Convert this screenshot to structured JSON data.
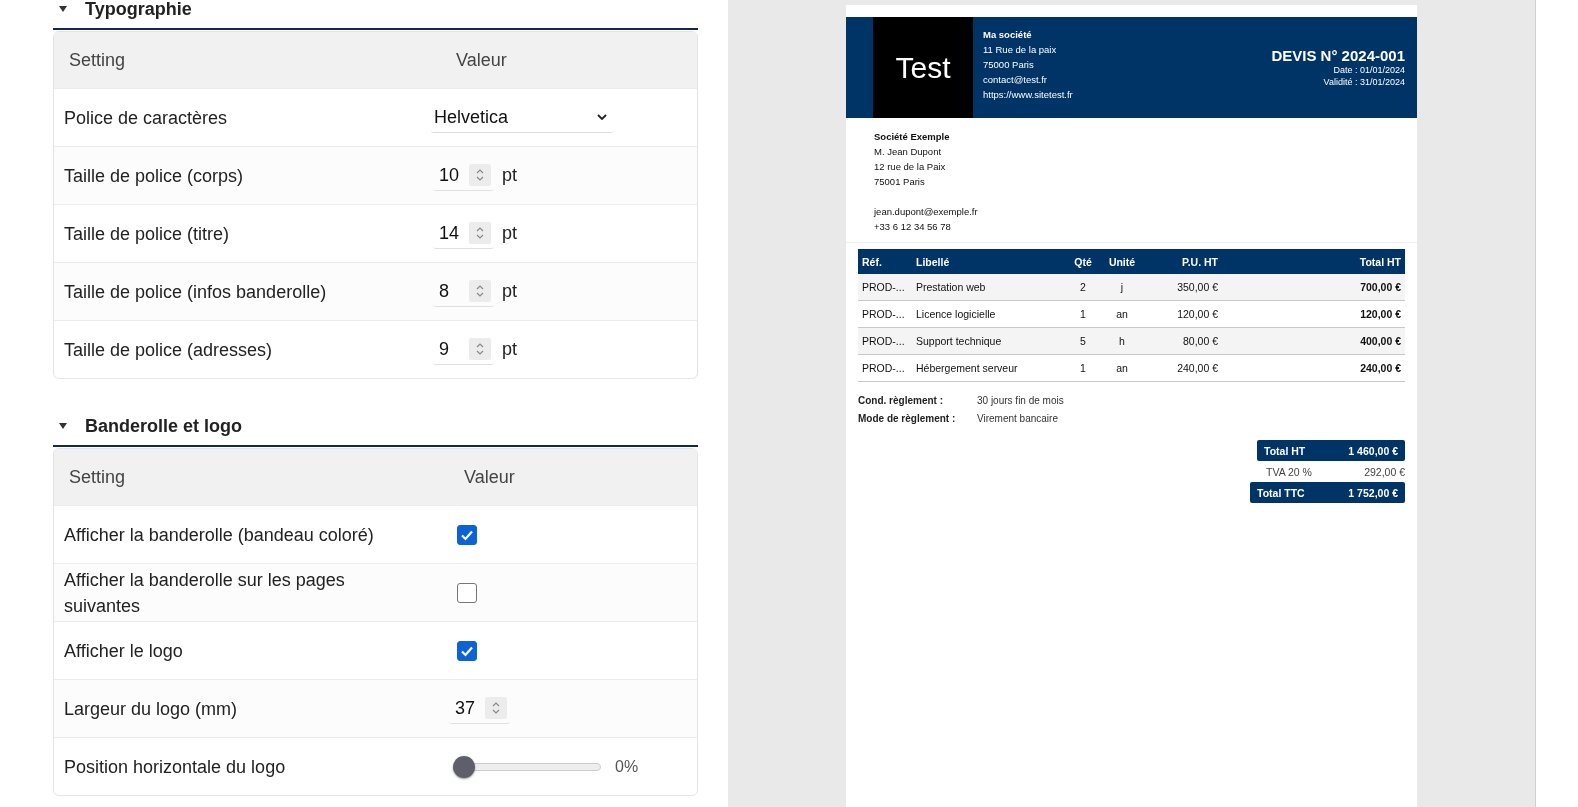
{
  "sections": [
    {
      "title": "Typographie",
      "expanded": true,
      "columns": [
        "Setting",
        "Valeur"
      ],
      "rows": [
        {
          "kind": "select",
          "label": "Police de caractères",
          "value": "Helvetica"
        },
        {
          "kind": "number",
          "label": "Taille de police (corps)",
          "value": "10",
          "unit": "pt"
        },
        {
          "kind": "number",
          "label": "Taille de police (titre)",
          "value": "14",
          "unit": "pt"
        },
        {
          "kind": "number",
          "label": "Taille de police (infos banderolle)",
          "value": "8",
          "unit": "pt"
        },
        {
          "kind": "number",
          "label": "Taille de police (adresses)",
          "value": "9",
          "unit": "pt"
        }
      ]
    },
    {
      "title": "Banderolle et logo",
      "expanded": true,
      "columns": [
        "Setting",
        "Valeur"
      ],
      "rows": [
        {
          "kind": "checkbox",
          "label": "Afficher la banderolle (bandeau coloré)",
          "checked": true
        },
        {
          "kind": "checkbox",
          "label": "Afficher la banderolle sur les pages suivantes",
          "checked": false
        },
        {
          "kind": "checkbox",
          "label": "Afficher le logo",
          "checked": true
        },
        {
          "kind": "number",
          "label": "Largeur du logo (mm)",
          "value": "37"
        },
        {
          "kind": "slider",
          "label": "Position horizontale du logo",
          "level": 0,
          "reading": "0%"
        }
      ]
    }
  ],
  "document": {
    "logo": "Test",
    "company": {
      "name": "Ma société",
      "lines": [
        "11 Rue de la paix",
        "75000 Paris",
        "contact@test.fr",
        "https://www.sitetest.fr"
      ]
    },
    "title": "DEVIS N° 2024-001",
    "date": "Date : 01/01/2024",
    "validity": "Validité : 31/01/2024",
    "client": {
      "name": "Société Exemple",
      "lines": [
        "M. Jean Dupont",
        "12 rue de la Paix",
        "75001 Paris"
      ],
      "contact": [
        "jean.dupont@exemple.fr",
        "+33 6 12 34 56 78"
      ]
    },
    "table": {
      "columns": [
        "Réf.",
        "Libellé",
        "Qté",
        "Unité",
        "P.U. HT",
        "Total HT"
      ],
      "rows": [
        [
          "PROD-...",
          "Prestation web",
          "2",
          "j",
          "350,00 €",
          "700,00 €"
        ],
        [
          "PROD-...",
          "Licence logicielle",
          "1",
          "an",
          "120,00 €",
          "120,00 €"
        ],
        [
          "PROD-...",
          "Support technique",
          "5",
          "h",
          "80,00 €",
          "400,00 €"
        ],
        [
          "PROD-...",
          "Hébergement serveur",
          "1",
          "an",
          "240,00 €",
          "240,00 €"
        ]
      ]
    },
    "payment": [
      {
        "label": "Cond. règlement :",
        "value": "30 jours fin de mois"
      },
      {
        "label": "Mode de règlement :",
        "value": "Virement bancaire"
      }
    ],
    "totals": [
      {
        "kind": "highlight",
        "label": "Total HT",
        "value": "1 460,00 €"
      },
      {
        "kind": "plain",
        "label": "TVA 20 %",
        "value": "292,00 €"
      },
      {
        "kind": "highlight",
        "label": "Total TTC",
        "value": "1 752,00 €"
      }
    ]
  }
}
